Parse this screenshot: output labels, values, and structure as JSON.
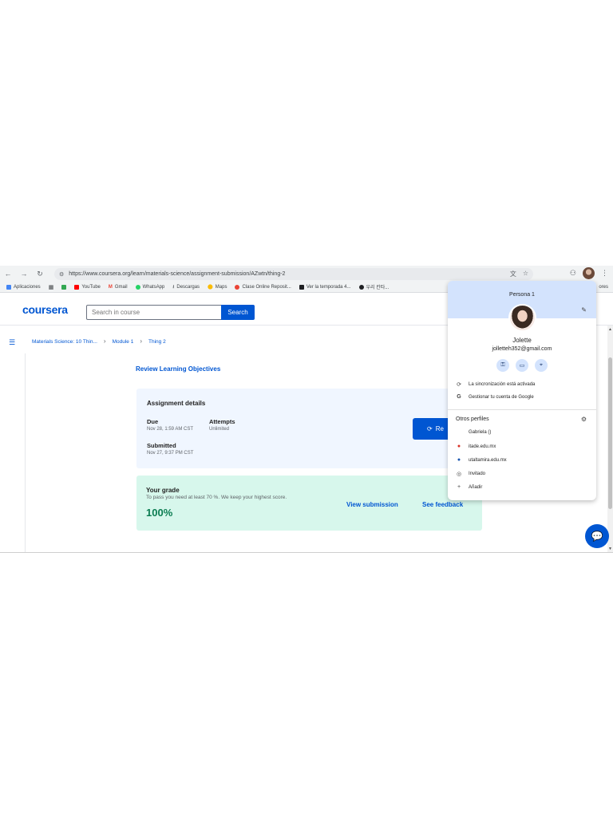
{
  "browser": {
    "url": "https://www.coursera.org/learn/materials-science/assignment-submission/AZwtn/thing-2",
    "bookmarks": [
      {
        "label": "Aplicaciones",
        "color": "#4285f4"
      },
      {
        "label": "",
        "color": "#34a853"
      },
      {
        "label": "YouTube",
        "color": "#ff0000"
      },
      {
        "label": "Gmail",
        "color": "#ea4335"
      },
      {
        "label": "WhatsApp",
        "color": "#25d366"
      },
      {
        "label": "Descargas",
        "color": "#5f6368"
      },
      {
        "label": "Maps",
        "color": "#fbbc04"
      },
      {
        "label": "Clase Online Reposit...",
        "color": "#ea4335"
      },
      {
        "label": "Ver la temporada 4...",
        "color": "#202124"
      },
      {
        "label": "우리 칸타...",
        "color": "#202124"
      }
    ],
    "bookmarks_overflow": "ores"
  },
  "header": {
    "logo": "coursera",
    "search_placeholder": "Search in course",
    "search_button": "Search"
  },
  "breadcrumb": [
    "Materials Science: 10 Thin...",
    "Module 1",
    "Thing 2"
  ],
  "main": {
    "review_link": "Review Learning Objectives",
    "assignment": {
      "title": "Assignment details",
      "due_label": "Due",
      "due_value": "Nov 28, 1:59 AM CST",
      "attempts_label": "Attempts",
      "attempts_value": "Unlimited",
      "submitted_label": "Submitted",
      "submitted_value": "Nov 27, 9:37 PM CST",
      "resume_button": "Re"
    },
    "grade": {
      "title": "Your grade",
      "subtitle": "To pass you need at least 70 %. We keep your highest score.",
      "value": "100%",
      "view_submission": "View submission",
      "see_feedback": "See feedback"
    }
  },
  "profile_menu": {
    "persona": "Persona 1",
    "name": "Jolette",
    "email": "jolletteh352@gmail.com",
    "sync_text": "La sincronización está activada",
    "manage_text": "Gestionar tu cuenta de Google",
    "other_profiles_label": "Otros perfiles",
    "profiles": [
      {
        "label": "Gabriela ()",
        "color": "#ffffff"
      },
      {
        "label": "itade.edu.mx",
        "color": "#d93025"
      },
      {
        "label": "utaltamira.edu.mx",
        "color": "#1a56b0"
      },
      {
        "label": "Invitado",
        "color": "#5f6368"
      },
      {
        "label": "Añadir",
        "color": "#5f6368"
      }
    ]
  }
}
